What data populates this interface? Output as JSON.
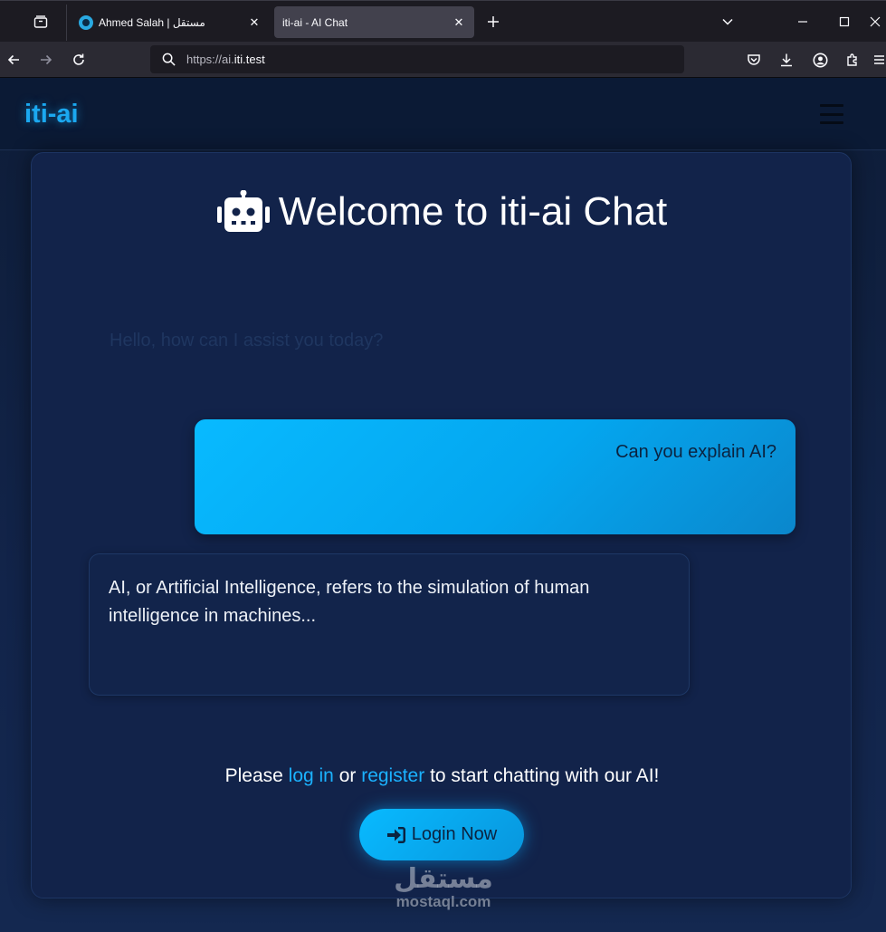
{
  "browser": {
    "tabs": [
      {
        "title": "Ahmed Salah | مستقل",
        "active": false
      },
      {
        "title": "iti-ai - AI Chat",
        "active": true
      }
    ],
    "url_prefix": "https://ai.",
    "url_domain": "iti.test"
  },
  "site": {
    "brand": "iti-ai"
  },
  "chat": {
    "title": "Welcome to iti-ai Chat",
    "placeholder": "Hello, how can I assist you today?",
    "user_message": "Can you explain AI?",
    "ai_message": "AI, or Artificial Intelligence, refers to the simulation of human intelligence in machines..."
  },
  "auth": {
    "prefix": "Please ",
    "login_link": "log in",
    "middle": " or ",
    "register_link": "register",
    "suffix": " to start chatting with our AI!",
    "button_label": "Login Now"
  },
  "watermark": {
    "logo": "مستقل",
    "site": "mostaql.com"
  },
  "colors": {
    "accent": "#1ba8f0",
    "page_bg": "#12234a"
  }
}
